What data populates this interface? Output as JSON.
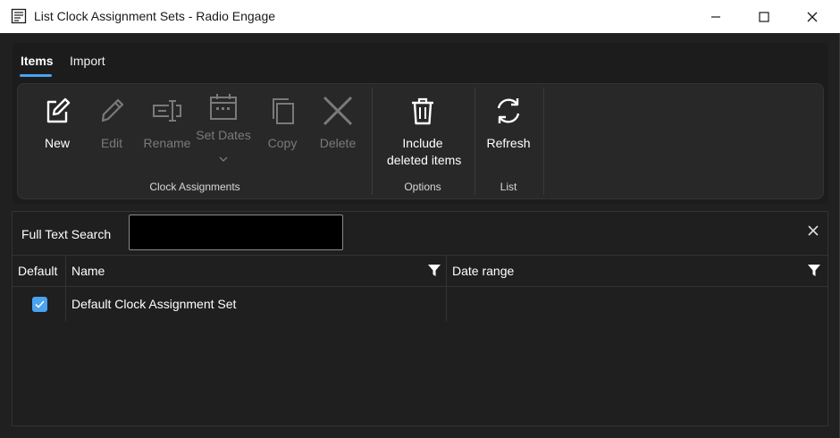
{
  "window": {
    "title": "List Clock Assignment Sets - Radio Engage",
    "app_icon": "document-list-icon",
    "controls": [
      "minimize-icon",
      "maximize-icon",
      "close-icon"
    ]
  },
  "tabs": [
    {
      "label": "Items",
      "active": true
    },
    {
      "label": "Import",
      "active": false
    }
  ],
  "ribbon": {
    "groups": [
      {
        "label": "Clock Assignments",
        "buttons": [
          {
            "label": "New",
            "icon": "edit-square-icon",
            "enabled": true
          },
          {
            "label": "Edit",
            "icon": "pencil-icon",
            "enabled": false
          },
          {
            "label": "Rename",
            "icon": "rename-icon",
            "enabled": false
          },
          {
            "label": "Set Dates",
            "icon": "calendar-icon",
            "enabled": false,
            "has_dropdown": true
          },
          {
            "label": "Copy",
            "icon": "copy-icon",
            "enabled": false
          },
          {
            "label": "Delete",
            "icon": "x-delete-icon",
            "enabled": false
          }
        ]
      },
      {
        "label": "Options",
        "buttons": [
          {
            "label_line1": "Include",
            "label_line2": "deleted items",
            "icon": "trash-icon",
            "enabled": true
          }
        ]
      },
      {
        "label": "List",
        "buttons": [
          {
            "label": "Refresh",
            "icon": "refresh-icon",
            "enabled": true
          }
        ]
      }
    ]
  },
  "search": {
    "label": "Full Text Search",
    "value": "",
    "clear_icon": "close-icon"
  },
  "grid": {
    "columns": [
      {
        "label": "Default",
        "filter": false
      },
      {
        "label": "Name",
        "filter": true
      },
      {
        "label": "Date range",
        "filter": true
      }
    ],
    "rows": [
      {
        "default": true,
        "name": "Default Clock Assignment Set",
        "date_range": ""
      }
    ]
  },
  "colors": {
    "accent": "#4aa3f0",
    "background": "#202020",
    "panel": "#282828",
    "text": "#ffffff",
    "disabled_text": "#7a7a7a"
  }
}
